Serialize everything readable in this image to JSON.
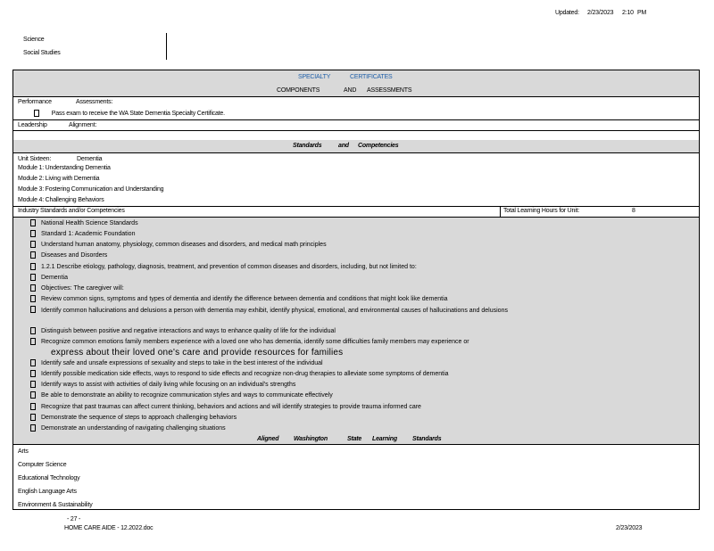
{
  "header": {
    "updated_label": "Updated:",
    "updated_date": "2/23/2023",
    "updated_time": "2:10",
    "updated_ampm": "PM"
  },
  "top_subjects": [
    "Science",
    "Social Studies"
  ],
  "specialty": {
    "line1a": "SPECIALTY",
    "line1b": "CERTIFICATES",
    "line2a": "COMPONENTS",
    "line2b": "AND",
    "line2c": "ASSESSMENTS"
  },
  "performance": {
    "label": "Performance",
    "assess_label": "Assessments:",
    "item": "Pass exam to receive the WA State Dementia Specialty Certificate."
  },
  "leadership": {
    "label": "Leadership",
    "alignment": "Alignment:"
  },
  "standards_header": {
    "a": "Standards",
    "b": "and",
    "c": "Competencies"
  },
  "unit": {
    "label": "Unit Sixteen:",
    "name": "Dementia"
  },
  "modules": [
    "Module 1: Understanding Dementia",
    "Module 2: Living with Dementia",
    "Module 3: Fostering Communication and Understanding",
    "Module 4: Challenging Behaviors"
  ],
  "industry": {
    "label": "Industry Standards and/or Competencies",
    "total_label": "Total Learning Hours for Unit:",
    "total_value": "8"
  },
  "standards_items": [
    "National Health Science Standards",
    "Standard 1: Academic Foundation",
    "Understand human anatomy, physiology, common diseases and disorders, and medical math principles",
    "Diseases and Disorders",
    "1.2.1 Describe etiology, pathology, diagnosis, treatment, and prevention of common diseases and disorders, including, but not limited to:",
    "Dementia",
    "Objectives: The caregiver will:",
    "Review common signs, symptoms and types of dementia and identify the difference between dementia and conditions that might look like dementia",
    "Identify common hallucinations and delusions a person with dementia may exhibit, identify physical, emotional, and environmental causes of hallucinations and delusions",
    "Distinguish between positive and negative interactions and ways to enhance quality of life for the individual",
    "Recognize common emotions family members experience with a loved one who has dementia, identify some difficulties family members may experience or",
    "Identify safe and unsafe expressions of sexuality and steps to take in the best interest of the individual",
    "Identify possible medication side effects, ways to respond to side effects and recognize non-drug therapies to alleviate some symptoms of dementia",
    "Identify ways to assist with activities of daily living while focusing on an individual's strengths",
    "Be able to demonstrate an ability to recognize communication styles and ways to communicate effectively",
    "Recognize that past traumas can affect current thinking, behaviors and actions and will identify strategies to provide trauma informed care",
    "Demonstrate the sequence of steps to approach challenging behaviors",
    "Demonstrate an understanding of navigating challenging situations"
  ],
  "express_line": "express about their loved one's care and provide resources for families",
  "aligned": {
    "a": "Aligned",
    "b": "Washington",
    "c": "State",
    "d": "Learning",
    "e": "Standards"
  },
  "aligned_subjects": [
    "Arts",
    "Computer Science",
    "Educational Technology",
    "English Language Arts",
    "Environment & Sustainability"
  ],
  "footer": {
    "page": "- 27 -",
    "doc": "HOME CARE AIDE - 12.2022.doc",
    "date": "2/23/2023"
  }
}
